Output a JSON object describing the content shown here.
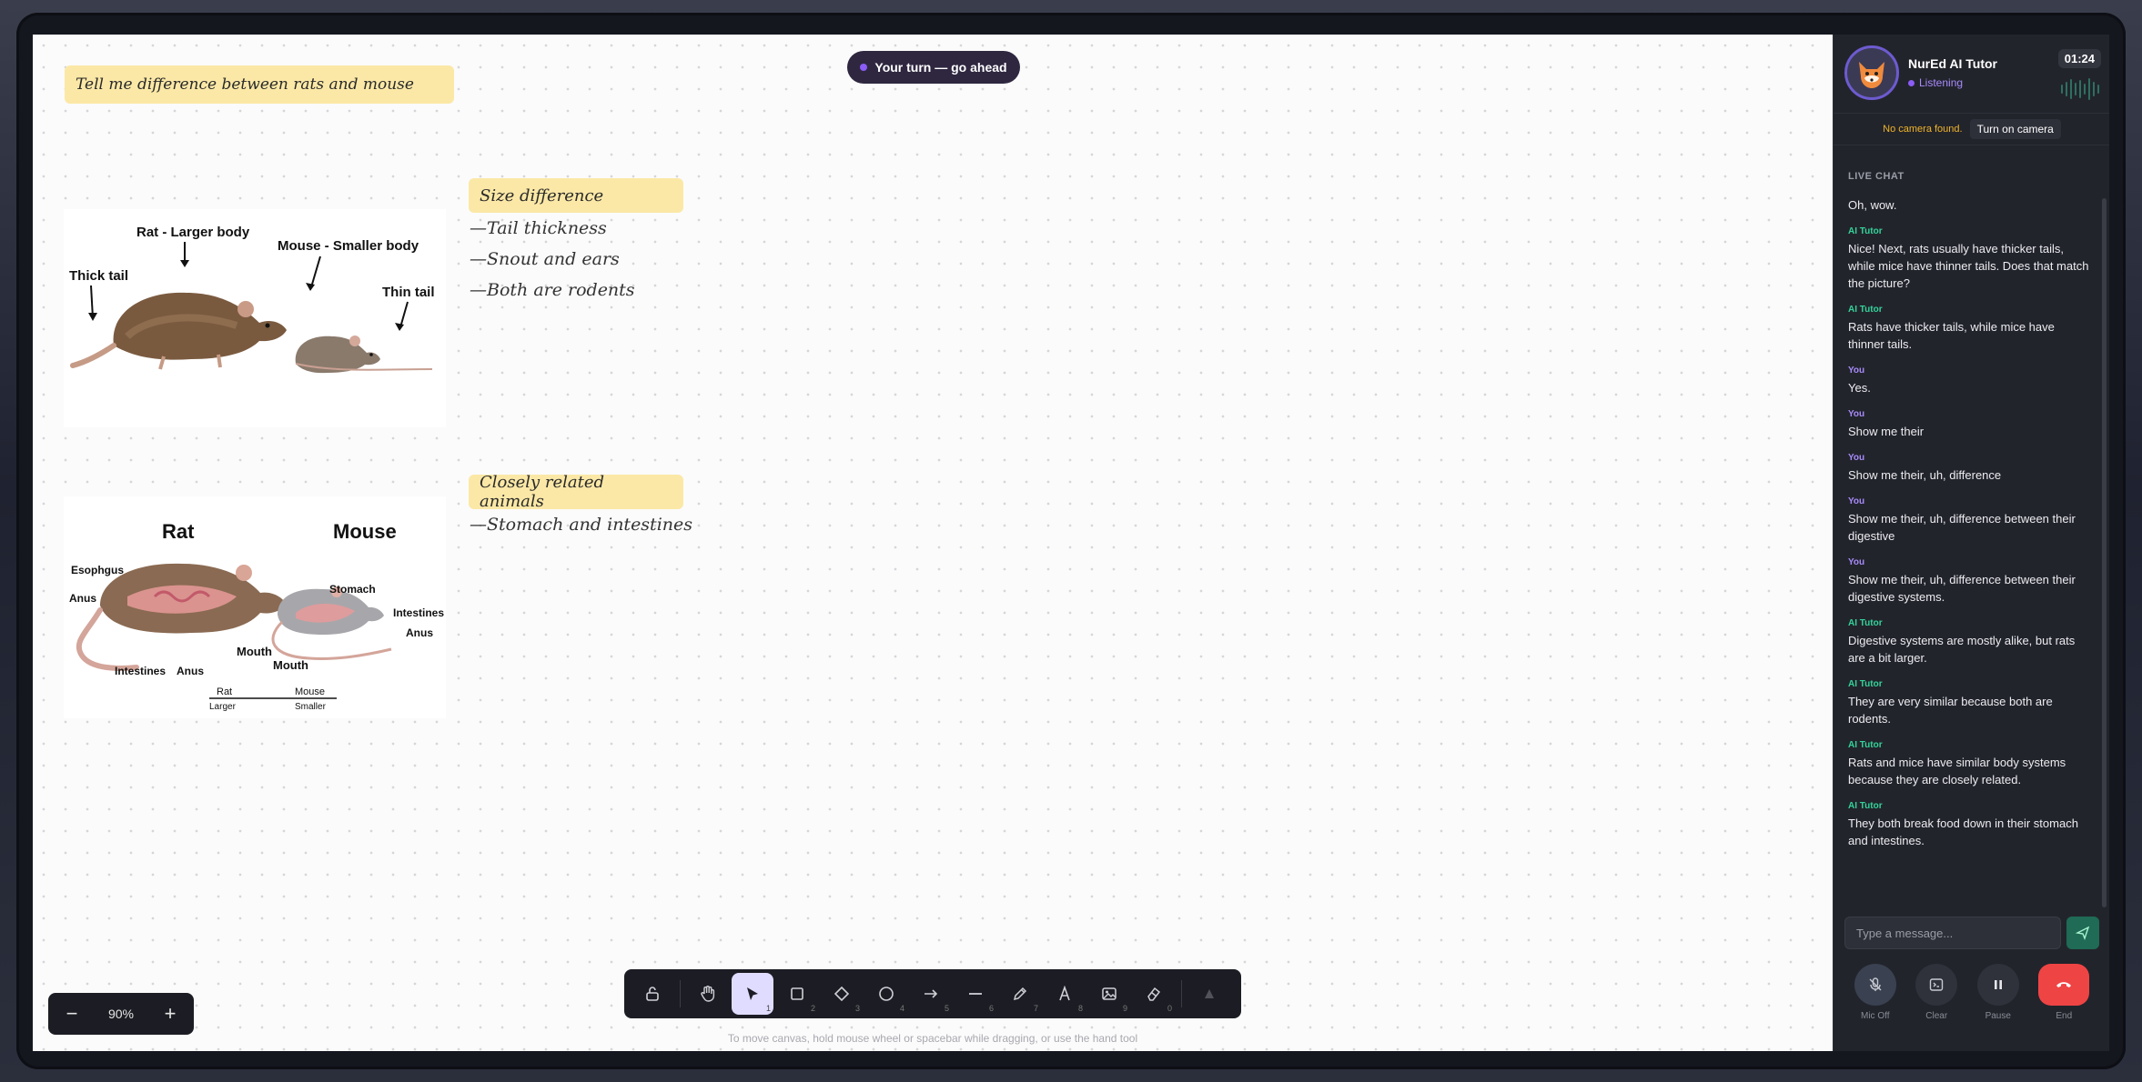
{
  "canvas": {
    "turn_indicator": "Your turn — go ahead",
    "question_note": "Tell me difference between rats and mouse",
    "section1": {
      "heading": "Size difference",
      "lines": [
        "—Tail thickness",
        "—Snout and ears",
        "—Both are rodents"
      ]
    },
    "section2": {
      "heading": "Closely related animals",
      "lines": [
        "—Stomach and intestines"
      ]
    },
    "image1_labels": {
      "rat": "Rat - Larger body",
      "mouse": "Mouse - Smaller body",
      "thick": "Thick tail",
      "thin": "Thin tail"
    },
    "image2_labels": {
      "rat": "Rat",
      "mouse": "Mouse",
      "esophagus": "Esophgus",
      "anus1": "Anus",
      "intestines1": "Intestines",
      "anus2": "Anus",
      "mouth1": "Mouth",
      "stomach": "Stomach",
      "intestines2": "Intestines",
      "anus3": "Anus",
      "mouth2": "Mouth",
      "scale_rat": "Rat",
      "scale_rat_sub": "Larger",
      "scale_mouse": "Mouse",
      "scale_mouse_sub": "Smaller"
    },
    "zoom": "90%",
    "zoom_minus": "−",
    "zoom_plus": "+",
    "tools": [
      {
        "name": "lock",
        "num": ""
      },
      {
        "name": "hand",
        "num": ""
      },
      {
        "name": "select",
        "num": "1"
      },
      {
        "name": "rectangle",
        "num": "2"
      },
      {
        "name": "diamond",
        "num": "3"
      },
      {
        "name": "ellipse",
        "num": "4"
      },
      {
        "name": "arrow",
        "num": "5"
      },
      {
        "name": "line",
        "num": "6"
      },
      {
        "name": "pencil",
        "num": "7"
      },
      {
        "name": "text",
        "num": "8"
      },
      {
        "name": "image",
        "num": "9"
      },
      {
        "name": "eraser",
        "num": "0"
      }
    ],
    "hint": "To move canvas, hold mouse wheel or spacebar while dragging, or use the hand tool"
  },
  "panel": {
    "tutor_name": "NurEd AI Tutor",
    "status": "Listening",
    "timer": "01:24",
    "camera_warning": "No camera found.",
    "camera_button": "Turn on camera",
    "live_chat_label": "LIVE CHAT",
    "messages": [
      {
        "who": "",
        "role": "none",
        "text": "Oh, wow."
      },
      {
        "who": "AI Tutor",
        "role": "ai",
        "text": "Nice! Next, rats usually have thicker tails, while mice have thinner tails. Does that match the picture?"
      },
      {
        "who": "AI Tutor",
        "role": "ai",
        "text": "Rats have thicker tails, while mice have thinner tails."
      },
      {
        "who": "You",
        "role": "you",
        "text": "Yes."
      },
      {
        "who": "You",
        "role": "you",
        "text": "Show me their"
      },
      {
        "who": "You",
        "role": "you",
        "text": "Show me their, uh, difference"
      },
      {
        "who": "You",
        "role": "you",
        "text": "Show me their, uh, difference between their digestive"
      },
      {
        "who": "You",
        "role": "you",
        "text": "Show me their, uh, difference between their digestive systems."
      },
      {
        "who": "AI Tutor",
        "role": "ai",
        "text": "Digestive systems are mostly alike, but rats are a bit larger."
      },
      {
        "who": "AI Tutor",
        "role": "ai",
        "text": "They are very similar because both are rodents."
      },
      {
        "who": "AI Tutor",
        "role": "ai",
        "text": "Rats and mice have similar body systems because they are closely related."
      },
      {
        "who": "AI Tutor",
        "role": "ai",
        "text": "They both break food down in their stomach and intestines."
      }
    ],
    "input_placeholder": "Type a message...",
    "controls": {
      "mic": "Mic Off",
      "clear": "Clear",
      "pause": "Pause",
      "end": "End"
    }
  }
}
